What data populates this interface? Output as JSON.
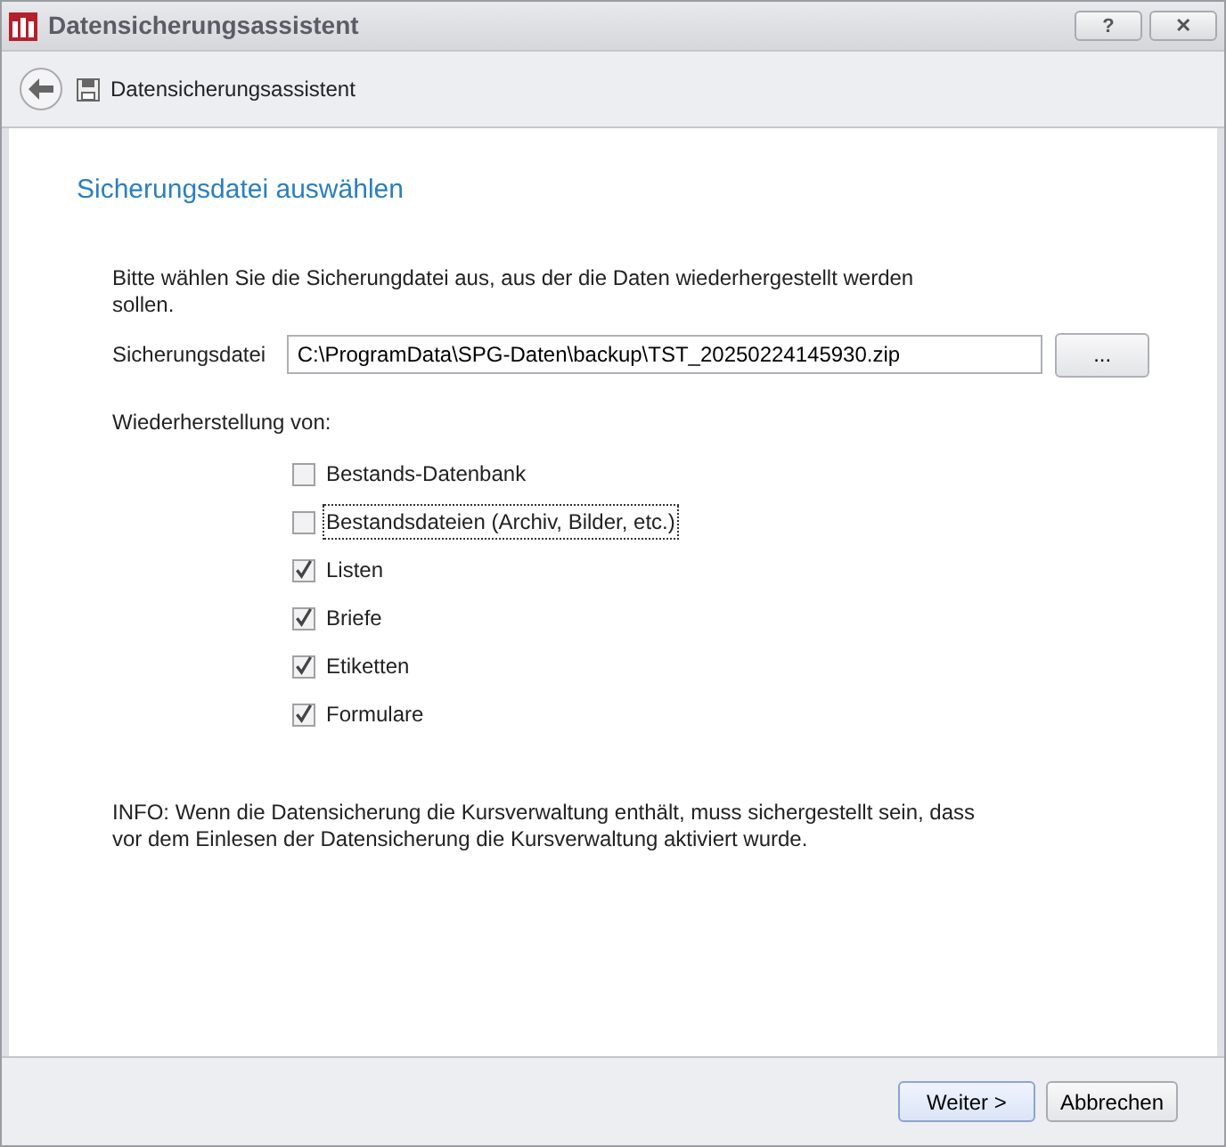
{
  "window": {
    "title": "Datensicherungsassistent",
    "buttons": [
      "?",
      "✕"
    ]
  },
  "header": {
    "title": "Datensicherungsassistent"
  },
  "page": {
    "heading": "Sicherungsdatei auswählen",
    "instruction": "Bitte wählen Sie die Sicherungdatei aus, aus der die Daten wiederhergestellt werden sollen.",
    "file": {
      "label": "Sicherungsdatei",
      "value": "C:\\ProgramData\\SPG-Daten\\backup\\TST_20250224145930.zip",
      "browse": "..."
    },
    "restore_label": "Wiederherstellung von:",
    "options": [
      {
        "label": "Bestands-Datenbank",
        "checked": false,
        "focused": false
      },
      {
        "label": "Bestandsdateien (Archiv, Bilder, etc.)",
        "checked": false,
        "focused": true
      },
      {
        "label": "Listen",
        "checked": true,
        "focused": false
      },
      {
        "label": "Briefe",
        "checked": true,
        "focused": false
      },
      {
        "label": "Etiketten",
        "checked": true,
        "focused": false
      },
      {
        "label": "Formulare",
        "checked": true,
        "focused": false
      }
    ],
    "info": "INFO: Wenn die Datensicherung die Kursverwaltung enthält, muss sichergestellt sein, dass vor dem Einlesen der Datensicherung die Kursverwaltung aktiviert wurde."
  },
  "footer": {
    "buttons": [
      {
        "label": "Weiter >",
        "default": true
      },
      {
        "label": "Abbrechen",
        "default": false
      }
    ]
  }
}
